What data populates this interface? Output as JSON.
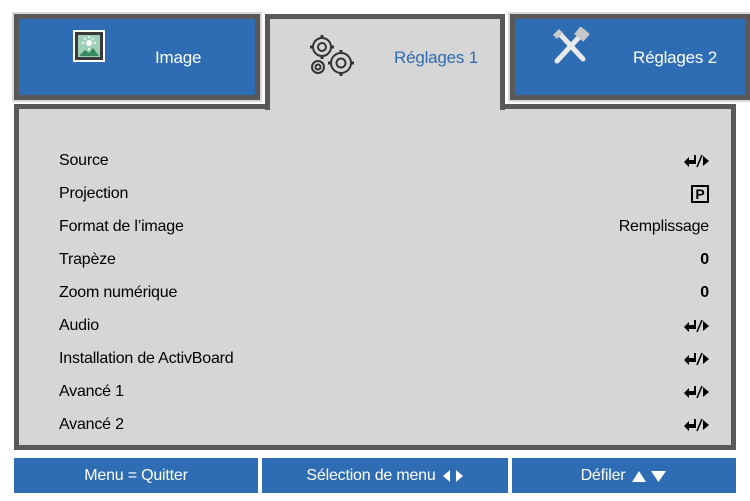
{
  "tabs": [
    {
      "label": "Image",
      "icon": "image-icon",
      "active": false
    },
    {
      "label": "Réglages 1",
      "icon": "gears-icon",
      "active": true
    },
    {
      "label": "Réglages 2",
      "icon": "tools-icon",
      "active": false
    }
  ],
  "menu": {
    "items": [
      {
        "label": "Source",
        "value_type": "enter-icon",
        "value": ""
      },
      {
        "label": "Projection",
        "value_type": "p-icon",
        "value": "P"
      },
      {
        "label": "Format de l’image",
        "value_type": "text",
        "value": "Remplissage"
      },
      {
        "label": "Trapèze",
        "value_type": "number",
        "value": "0"
      },
      {
        "label": "Zoom numérique",
        "value_type": "number",
        "value": "0"
      },
      {
        "label": "Audio",
        "value_type": "enter-icon",
        "value": ""
      },
      {
        "label": "Installation de ActivBoard",
        "value_type": "enter-icon",
        "value": ""
      },
      {
        "label": "Avancé 1",
        "value_type": "enter-icon",
        "value": ""
      },
      {
        "label": "Avancé 2",
        "value_type": "enter-icon",
        "value": ""
      }
    ]
  },
  "footer": {
    "exit_label": "Menu = Quitter",
    "select_label": "Sélection de menu",
    "scroll_label": "Défiler"
  },
  "colors": {
    "accent_blue": "#2e6db4",
    "panel_gray": "#d6d6d6",
    "border_dark": "#595959",
    "active_text": "#2f6cb3"
  }
}
